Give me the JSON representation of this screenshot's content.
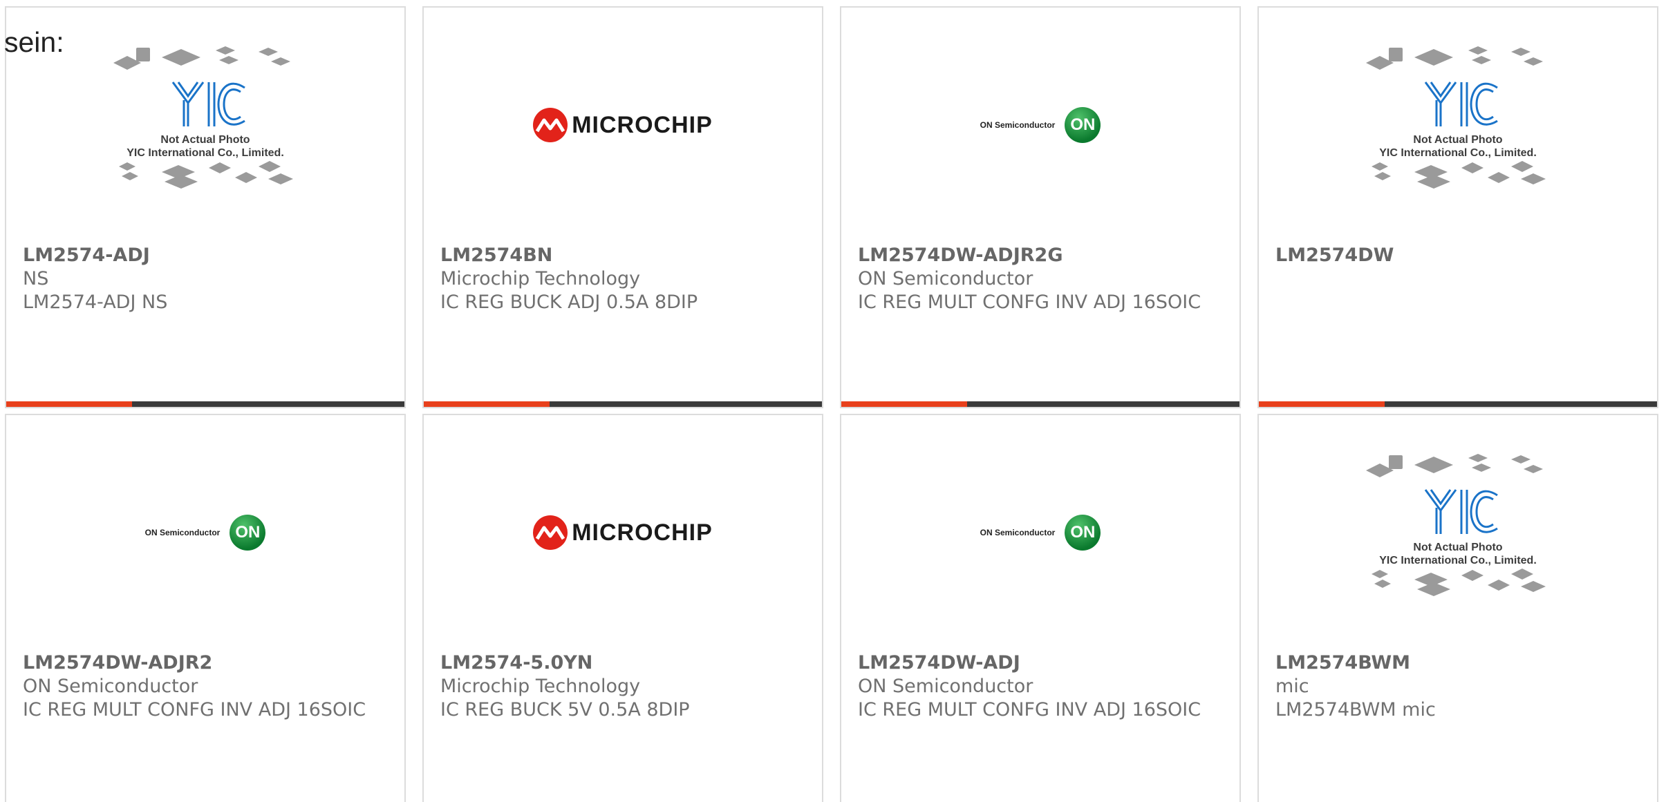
{
  "intro_text": "sein:",
  "placeholder": {
    "brand": "YIC",
    "line1": "Not Actual Photo",
    "line2": "YIC International Co., Limited."
  },
  "logos": {
    "microchip": "MICROCHIP",
    "on_semi": "ON Semiconductor",
    "on_badge": "ON"
  },
  "colors": {
    "accent": "#e8401c",
    "bar": "#3a3a3a",
    "microchip_red": "#e2231a",
    "on_green": "#0b7a2e",
    "yic_blue": "#1a73c8"
  },
  "products": [
    {
      "part": "LM2574-ADJ",
      "manufacturer": "NS",
      "description": "LM2574-ADJ NS",
      "image": "yic-placeholder"
    },
    {
      "part": "LM2574BN",
      "manufacturer": "Microchip Technology",
      "description": "IC REG BUCK ADJ 0.5A 8DIP",
      "image": "microchip-logo"
    },
    {
      "part": "LM2574DW-ADJR2G",
      "manufacturer": "ON Semiconductor",
      "description": "IC REG MULT CONFG INV ADJ 16SOIC",
      "image": "on-semiconductor-logo"
    },
    {
      "part": "LM2574DW",
      "manufacturer": "",
      "description": "",
      "image": "yic-placeholder"
    },
    {
      "part": "LM2574DW-ADJR2",
      "manufacturer": "ON Semiconductor",
      "description": "IC REG MULT CONFG INV ADJ 16SOIC",
      "image": "on-semiconductor-logo"
    },
    {
      "part": "LM2574-5.0YN",
      "manufacturer": "Microchip Technology",
      "description": "IC REG BUCK 5V 0.5A 8DIP",
      "image": "microchip-logo"
    },
    {
      "part": "LM2574DW-ADJ",
      "manufacturer": "ON Semiconductor",
      "description": "IC REG MULT CONFG INV ADJ 16SOIC",
      "image": "on-semiconductor-logo"
    },
    {
      "part": "LM2574BWM",
      "manufacturer": "mic",
      "description": "LM2574BWM mic",
      "image": "yic-placeholder"
    }
  ]
}
